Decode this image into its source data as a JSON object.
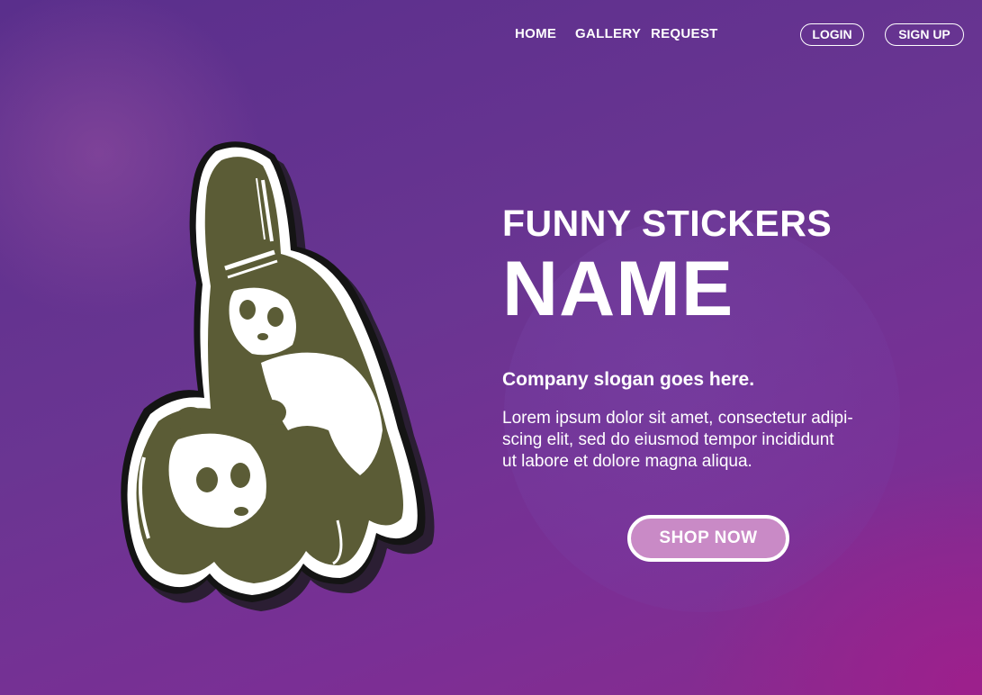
{
  "nav": {
    "links": [
      {
        "label": "HOME"
      },
      {
        "label": "GALLERY"
      },
      {
        "label": "REQUEST"
      }
    ],
    "login_label": "LOGIN",
    "signup_label": "SIGN UP"
  },
  "hero": {
    "title_small": "FUNNY STICKERS",
    "title_large": "NAME",
    "slogan": "Company slogan goes here.",
    "body_lines": [
      "Lorem ipsum dolor sit amet, consectetur adipi-",
      "scing elit, sed do eiusmod tempor incididunt",
      "ut labore et dolore magna aliqua."
    ],
    "cta_label": "SHOP NOW"
  },
  "sticker": {
    "icon": "panda-sticker-icon",
    "fill_color": "#5b5c36",
    "border_color": "#ffffff",
    "outline_color": "#1a1a1a"
  },
  "colors": {
    "background": "#6a3592",
    "accent": "#c98ac6",
    "text": "#ffffff"
  }
}
